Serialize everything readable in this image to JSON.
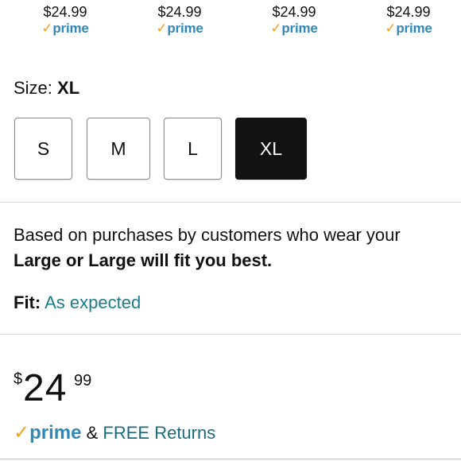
{
  "variants": [
    {
      "price": "$24.99",
      "prime": "prime"
    },
    {
      "price": "$24.99",
      "prime": "prime"
    },
    {
      "price": "$24.99",
      "prime": "prime"
    },
    {
      "price": "$24.99",
      "prime": "prime"
    }
  ],
  "size": {
    "label": "Size:",
    "selected": "XL",
    "options": [
      "S",
      "M",
      "L",
      "XL"
    ]
  },
  "fit_recommendation": {
    "line1": "Based on purchases by customers who wear your",
    "line2": "Large or Large will fit you best.",
    "fit_label": "Fit:",
    "fit_value": "As expected"
  },
  "price": {
    "currency": "$",
    "whole": "24",
    "fraction": "99"
  },
  "delivery": {
    "prime": "prime",
    "ampersand": "&",
    "returns": "FREE Returns"
  },
  "colors": {
    "prime_blue": "#2e88b8",
    "prime_check": "#f0a21a",
    "link_teal": "#1a7c8c",
    "selected_bg": "#121212"
  },
  "icons": {
    "prime_check": "check-icon"
  }
}
